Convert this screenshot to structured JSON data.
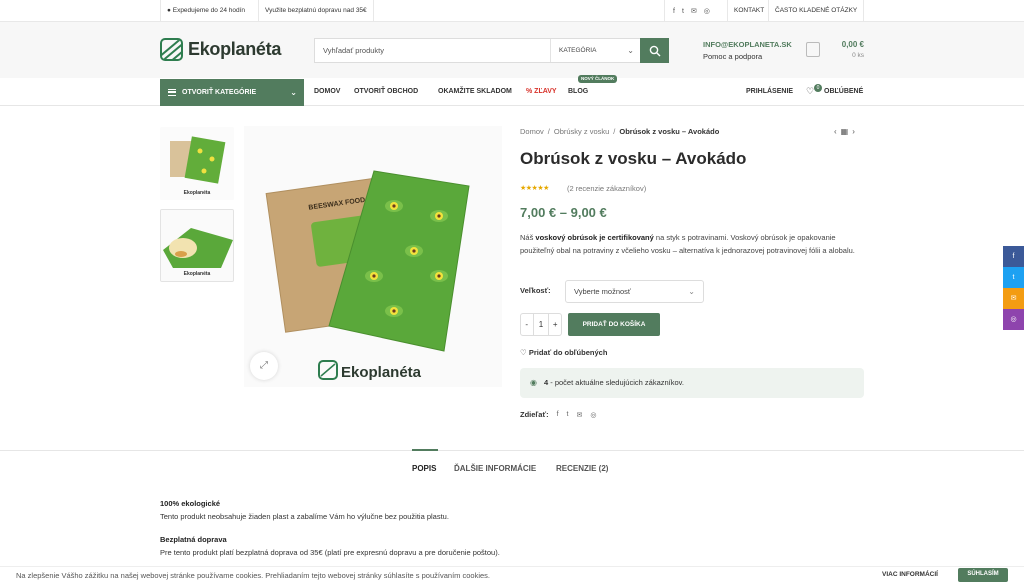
{
  "topbar": {
    "shipping": "Expedujeme do 24 hodín",
    "free_shipping": "Využite bezplatnú dopravu nad 35€",
    "social": [
      "f",
      "t",
      "✉",
      "◎"
    ],
    "contact": "KONTAKT",
    "faq": "ČASTO KLADENÉ OTÁZKY"
  },
  "header": {
    "logo": "Ekoplanéta",
    "search_placeholder": "Vyhľadať produkty",
    "search_category": "KATEGÓRIA",
    "email": "INFO@EKOPLANETA.SK",
    "support": "Pomoc a podpora",
    "cart_amount": "0,00 €",
    "cart_qty": "0 ks"
  },
  "nav": {
    "categories": "OTVORIŤ KATEGÓRIE",
    "items": [
      "DOMOV",
      "OTVORIŤ OBCHOD",
      "OKAMŽITE SKLADOM",
      "% ZĽAVY",
      "BLOG"
    ],
    "blog_badge": "NOVÝ ČLÁNOK",
    "login": "PRIHLÁSENIE",
    "wishlist": "OBĽÚBENÉ",
    "wishlist_count": "0"
  },
  "gallery": {
    "thumb_logo": "Ekoplanéta",
    "main_logo": "Ekoplanéta",
    "pack_text": "BEESWAX FOOD WRAPS"
  },
  "product": {
    "breadcrumb": [
      "Domov",
      "Obrúsky z vosku",
      "Obrúsok z vosku – Avokádo"
    ],
    "title": "Obrúsok z vosku – Avokádo",
    "stars": "★★★★★",
    "reviews": "(2 recenzie zákazníkov)",
    "price": "7,00 € – 9,00 €",
    "desc_prefix": "Náš ",
    "desc_bold": "voskový obrúsok je certifikovaný",
    "desc_rest": " na styk s potravinami. Voskový obrúsok je opakovanie použiteľný obal na potraviny z včelieho vosku – alternatíva k jednorazovej potravinovej fólii a alobalu.",
    "variant_label": "Veľkosť:",
    "variant_value": "Vyberte možnosť",
    "qty": "1",
    "add_to_cart": "PRIDAŤ DO KOŠÍKA",
    "add_wishlist": "Pridať do obľúbených",
    "watchers_count": "4",
    "watchers_text": " - počet aktuálne sledujúcich zákazníkov.",
    "share_label": "Zdieľať:"
  },
  "tabs": [
    "POPIS",
    "ĎALŠIE INFORMÁCIE",
    "RECENZIE (2)"
  ],
  "description": {
    "h1": "100% ekologické",
    "p1": "Tento produkt neobsahuje žiaden plast a zabalíme Vám ho výlučne bez použitia plastu.",
    "h2": "Bezplatná doprava",
    "p2": "Pre tento produkt platí bezplatná doprava od 35€ (platí pre expresnú dopravu a pre doručenie poštou)."
  },
  "cookie": {
    "text": "Na zlepšenie Vášho zážitku na našej webovej stránke používame cookies. Prehliadaním tejto webovej stránky súhlasíte s používaním cookies.",
    "more": "VIAC INFORMÁCIÍ",
    "ok": "SÚHLASÍM"
  },
  "colors": {
    "accent": "#527c5e",
    "sale": "#d8322a",
    "star": "#e6a800",
    "wrap_green": "#5aa83a"
  }
}
